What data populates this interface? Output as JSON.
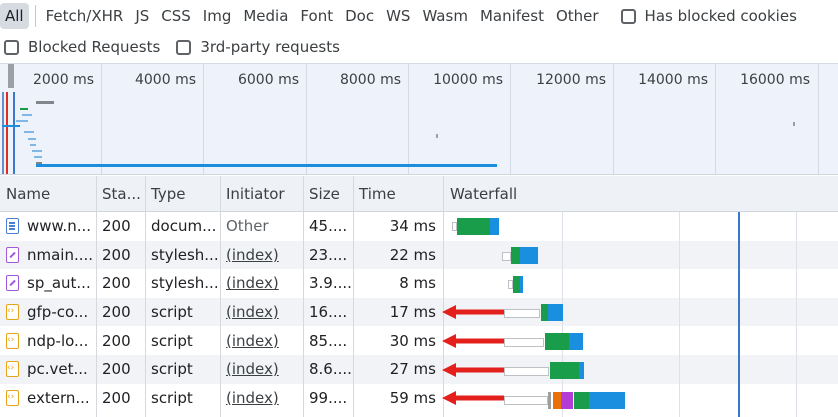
{
  "filters": {
    "types": [
      "All",
      "Fetch/XHR",
      "JS",
      "CSS",
      "Img",
      "Media",
      "Font",
      "Doc",
      "WS",
      "Wasm",
      "Manifest",
      "Other"
    ],
    "has_blocked_cookies": "Has blocked cookies",
    "blocked_requests": "Blocked Requests",
    "third_party": "3rd-party requests"
  },
  "overview": {
    "ticks": [
      "2000 ms",
      "4000 ms",
      "6000 ms",
      "8000 ms",
      "10000 ms",
      "12000 ms",
      "14000 ms",
      "16000 ms"
    ]
  },
  "table": {
    "headers": [
      "Name",
      "Sta...",
      "Type",
      "Initiator",
      "Size",
      "Time",
      "Waterfall"
    ],
    "rows": [
      {
        "icon": "document-icon",
        "name": "www.n...",
        "status": "200",
        "type": "docum...",
        "initiator": "Other",
        "size": "45....",
        "time": "34 ms"
      },
      {
        "icon": "stylesheet-icon",
        "name": "nmain....",
        "status": "200",
        "type": "stylesh...",
        "initiator": "(index)",
        "size": "23....",
        "time": "22 ms"
      },
      {
        "icon": "stylesheet-icon",
        "name": "sp_aut...",
        "status": "200",
        "type": "stylesh...",
        "initiator": "(index)",
        "size": "3.9....",
        "time": "8 ms"
      },
      {
        "icon": "script-icon",
        "name": "gfp-co...",
        "status": "200",
        "type": "script",
        "initiator": "(index)",
        "size": "16....",
        "time": "17 ms"
      },
      {
        "icon": "script-icon",
        "name": "ndp-lo...",
        "status": "200",
        "type": "script",
        "initiator": "(index)",
        "size": "85....",
        "time": "30 ms"
      },
      {
        "icon": "script-icon",
        "name": "pc.vet...",
        "status": "200",
        "type": "script",
        "initiator": "(index)",
        "size": "8.6....",
        "time": "27 ms"
      },
      {
        "icon": "script-icon",
        "name": "extern...",
        "status": "200",
        "type": "script",
        "initiator": "(index)",
        "size": "99....",
        "time": "59 ms"
      }
    ]
  },
  "colors": {
    "waiting": "#1a9d4b",
    "download": "#1a8fe0",
    "queue": "#e8eaed",
    "annotation_arrow": "#e3201b",
    "timeline_marker": "#3a78c9"
  }
}
